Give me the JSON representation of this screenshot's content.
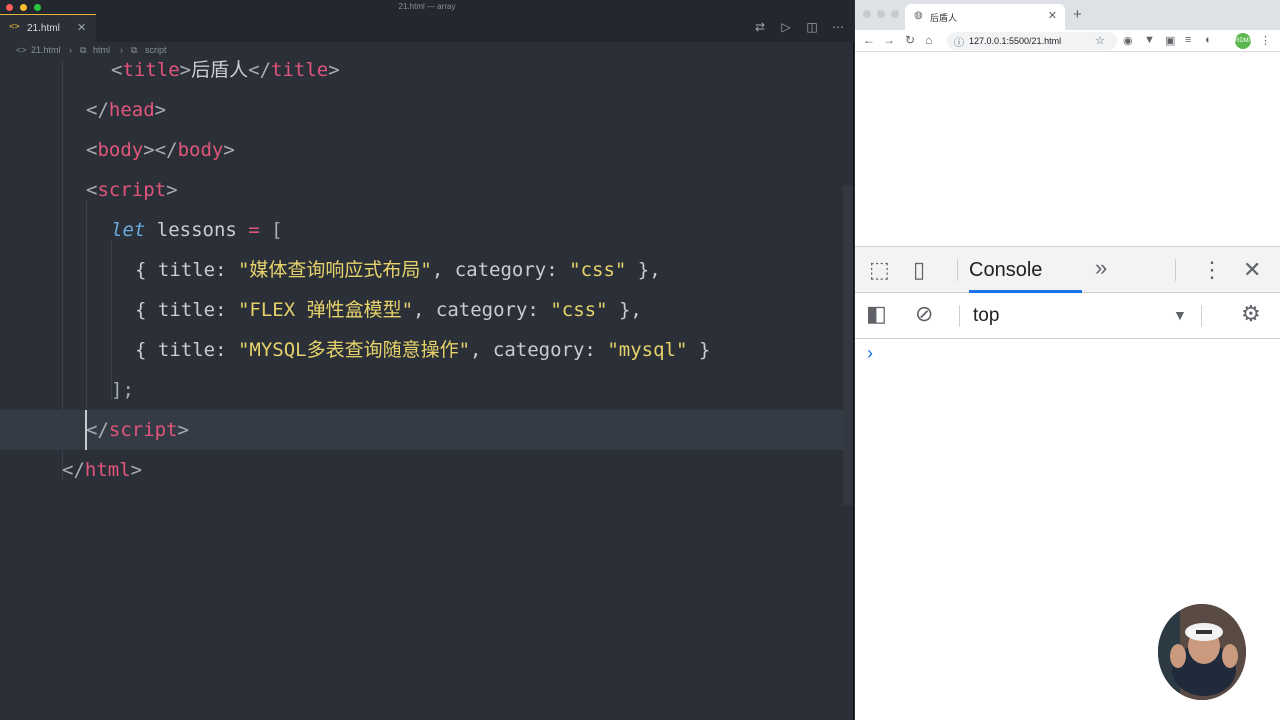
{
  "window": {
    "title": "21.html — array"
  },
  "editor": {
    "tab": {
      "label": "21.html"
    },
    "breadcrumb": [
      "21.html",
      "html",
      "script"
    ],
    "code": {
      "l_title_open": "<",
      "l_title_tag": "title",
      "l_title_close": ">",
      "l_title_text": "后盾人",
      "l_title_end_open": "</",
      "l_title_end_tag": "title",
      "l_title_end_close": ">",
      "l_head_open": "</",
      "l_head_tag": "head",
      "l_head_close": ">",
      "l_body_open1": "<",
      "l_body_tag1": "body",
      "l_body_close1": ">",
      "l_body_open2": "</",
      "l_body_tag2": "body",
      "l_body_close2": ">",
      "l_script_open": "<",
      "l_script_tag": "script",
      "l_script_close": ">",
      "l_let": "let",
      "l_lessons": " lessons ",
      "l_eq": "=",
      "l_bracket": " [",
      "r1_pre": "{ title: ",
      "r1_title": "\"媒体查询响应式布局\"",
      "r1_mid": ", category: ",
      "r1_cat": "\"css\"",
      "r1_post": " },",
      "r2_pre": "{ title: ",
      "r2_title": "\"FLEX 弹性盒模型\"",
      "r2_mid": ", category: ",
      "r2_cat": "\"css\"",
      "r2_post": " },",
      "r3_pre": "{ title: ",
      "r3_title": "\"MYSQL多表查询随意操作\"",
      "r3_mid": ", category: ",
      "r3_cat": "\"mysql\"",
      "r3_post": " }",
      "l_end_arr": "];",
      "l_script_end_open": "</",
      "l_script_end_tag": "script",
      "l_script_end_close": ">",
      "l_html_end_open": "</",
      "l_html_end_tag": "html",
      "l_html_end_close": ">"
    }
  },
  "browser": {
    "tab_title": "后盾人",
    "url": "127.0.0.1:5500/21.html",
    "avatar_text": "RDMX",
    "devtools": {
      "active_tab": "Console",
      "more": "»",
      "context": "top",
      "prompt": "›"
    }
  },
  "colors": {
    "accent": "#1a73e8",
    "tag": "#e05579",
    "string": "#e6d26a",
    "keyword": "#6aa9d8",
    "editor_bg": "#2b3038"
  }
}
